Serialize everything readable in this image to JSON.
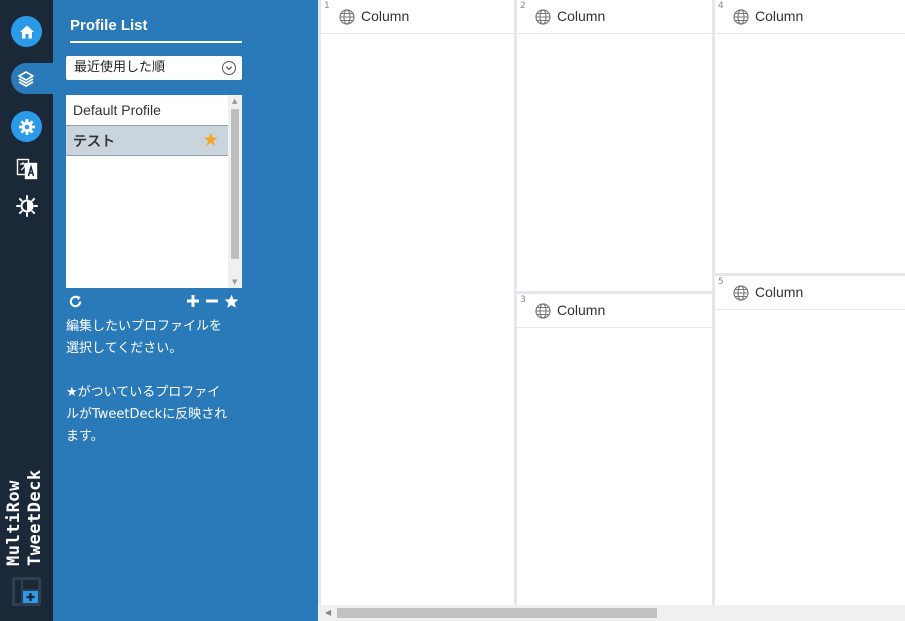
{
  "app": {
    "title_line1": "MultiRow",
    "title_line2": "TweetDeck"
  },
  "rail": {
    "icons": [
      "home-icon",
      "layers-icon",
      "gear-icon",
      "translate-icon",
      "brightness-icon",
      "add-column-logo-icon"
    ]
  },
  "panel": {
    "title": "Profile List",
    "sort_value": "最近使用した順",
    "profiles": [
      {
        "name": "Default Profile",
        "selected": false,
        "active": false
      },
      {
        "name": "テスト",
        "selected": true,
        "active": true
      }
    ],
    "help_line1": "編集したいプロファイルを",
    "help_line2": "選択してください。",
    "help_line3": "★がついているプロファイ",
    "help_line4": "ルがTweetDeckに反映され",
    "help_line5": "ます。"
  },
  "columns": [
    {
      "number": "1",
      "label": "Column"
    },
    {
      "number": "2",
      "label": "Column"
    },
    {
      "number": "3",
      "label": "Column"
    },
    {
      "number": "4",
      "label": "Column"
    },
    {
      "number": "5",
      "label": "Column"
    }
  ],
  "colors": {
    "rail_bg": "#1b2838",
    "panel_bg": "#2a7ab9",
    "accent_blue": "#2b9be8",
    "star": "#f5a623"
  }
}
